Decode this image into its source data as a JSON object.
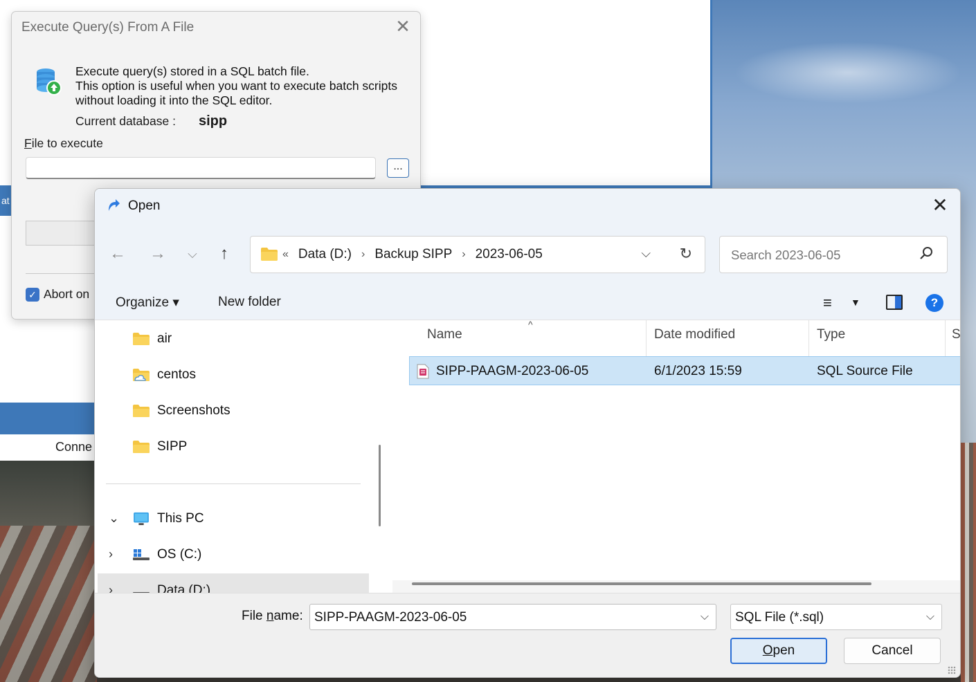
{
  "background": {
    "side_tab_text": "at",
    "connection_text": "Conne"
  },
  "exec_dialog": {
    "title": "Execute Query(s) From A File",
    "desc_line1": "Execute query(s) stored in a SQL batch file.",
    "desc_line2": "This option is useful when you want to execute batch scripts",
    "desc_line3": "without loading it into the SQL editor.",
    "current_db_label": "Current database :",
    "current_db_value": "sipp",
    "file_label_rest": "ile to execute",
    "file_label_key": "F",
    "file_value": "",
    "browse_label": "...",
    "abort_label": "Abort on"
  },
  "open_dialog": {
    "title": "Open",
    "address": {
      "overflow": "«",
      "crumbs": [
        "Data (D:)",
        "Backup SIPP",
        "2023-06-05"
      ]
    },
    "search_placeholder": "Search 2023-06-05",
    "toolbar": {
      "organize_label": "Organize ▾",
      "new_folder_label": "New folder"
    },
    "nav_items": [
      {
        "label": "air",
        "icon": "folder-icon"
      },
      {
        "label": "centos",
        "icon": "cloud-folder-icon"
      },
      {
        "label": "Screenshots",
        "icon": "folder-icon"
      },
      {
        "label": "SIPP",
        "icon": "folder-icon"
      }
    ],
    "nav_tree": [
      {
        "label": "This PC",
        "icon": "computer-icon",
        "expanded": true
      },
      {
        "label": "OS (C:)",
        "icon": "windows-drive-icon",
        "expanded": false
      },
      {
        "label": "Data (D:)",
        "icon": "drive-icon",
        "expanded": false
      }
    ],
    "columns": [
      "Name",
      "Date modified",
      "Type",
      "Si"
    ],
    "files": [
      {
        "name": "SIPP-PAAGM-2023-06-05",
        "date": "6/1/2023 15:59",
        "type": "SQL Source File"
      }
    ],
    "file_name_label_pre": "File ",
    "file_name_label_key": "n",
    "file_name_label_post": "ame:",
    "file_name_value": "SIPP-PAAGM-2023-06-05",
    "file_type_value": "SQL File (*.sql)",
    "open_button_key": "O",
    "open_button_rest": "pen",
    "cancel_button": "Cancel"
  },
  "colors": {
    "accent": "#2b6fd6",
    "selection": "#cce4f7",
    "folder": "#f4c542"
  }
}
